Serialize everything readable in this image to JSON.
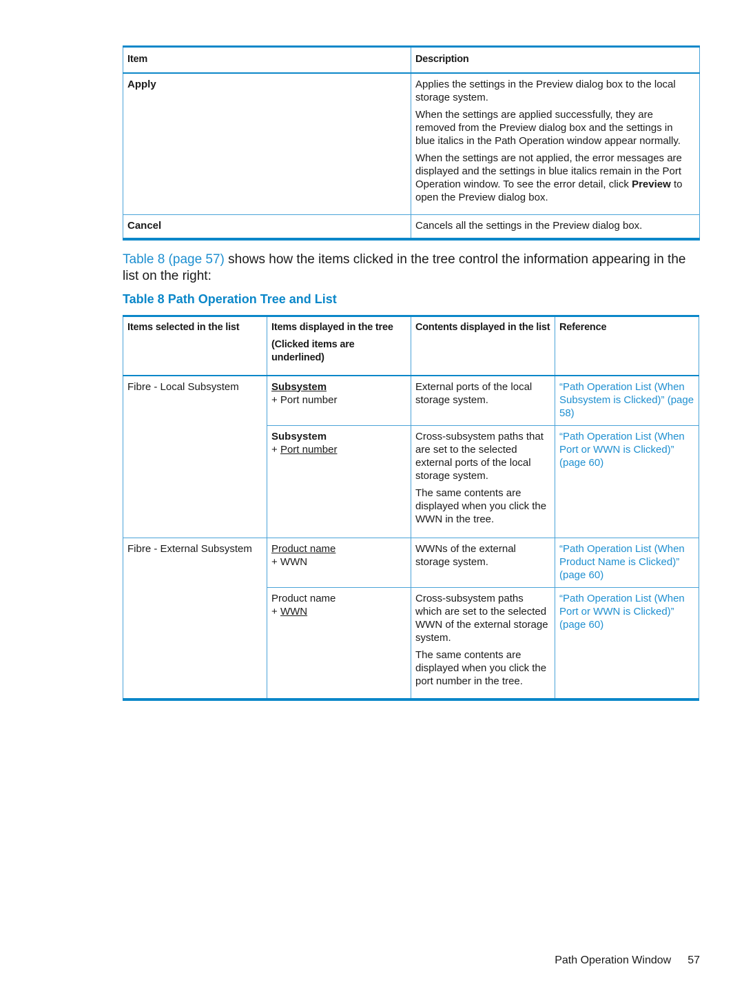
{
  "table7": {
    "headers": [
      "Item",
      "Description"
    ],
    "rows": [
      {
        "item": "Apply",
        "paragraphs": [
          "Applies the settings in the Preview dialog box to the local storage system.",
          "When the settings are applied successfully, they are removed from the Preview dialog box and the settings in blue italics in the Path Operation window appear normally."
        ],
        "para3_pre": "When the settings are not applied, the error messages are displayed and the settings in blue italics remain in the Port Operation window. To see the error detail, click ",
        "para3_bold": "Preview",
        "para3_post": " to open the Preview dialog box."
      },
      {
        "item": "Cancel",
        "paragraphs": [
          "Cancels all the settings in the Preview dialog box."
        ]
      }
    ]
  },
  "intro": {
    "link": "Table 8 (page 57)",
    "text": " shows how the items clicked in the tree control the information appearing in the list on the right:"
  },
  "caption": "Table 8 Path Operation Tree and List",
  "table8": {
    "headers": {
      "col1": "Items selected in the list",
      "col2_line1": "Items displayed in the tree",
      "col2_line2": "(Clicked items are underlined)",
      "col3": "Contents displayed in the list",
      "col4": "Reference"
    },
    "rows": [
      {
        "selected": "Fibre - Local Subsystem",
        "tree_top": "Subsystem",
        "tree_bottom": "+ Port number",
        "contents": [
          "External ports of the local storage system."
        ],
        "reference": "“Path Operation List (When Subsystem is Clicked)” (page 58)"
      },
      {
        "selected": "",
        "tree_top": "Subsystem",
        "tree_bottom_prefix": "+ ",
        "tree_bottom": "Port number",
        "contents": [
          "Cross-subsystem paths that are set to the selected external ports of the local storage system.",
          "The same contents are displayed when you click the WWN in the tree."
        ],
        "reference": "“Path Operation List (When Port or WWN is Clicked)” (page 60)"
      },
      {
        "selected": "Fibre - External Subsystem",
        "tree_top": "Product name",
        "tree_bottom": "+ WWN",
        "contents": [
          "WWNs of the external storage system."
        ],
        "reference": "“Path Operation List (When Product Name is Clicked)” (page 60)"
      },
      {
        "selected": "",
        "tree_top": "Product name",
        "tree_bottom_prefix": "+ ",
        "tree_bottom": "WWN",
        "contents": [
          "Cross-subsystem paths which are set to the selected WWN of the external storage system.",
          "The same contents are displayed when you click the port number in the tree."
        ],
        "reference": "“Path Operation List (When Port or WWN is Clicked)” (page 60)"
      }
    ]
  },
  "footer": {
    "section": "Path Operation Window",
    "page": "57"
  },
  "colors": {
    "accent": "#0b87c9",
    "link": "#1e8fd0",
    "border": "#4aa3d8"
  }
}
